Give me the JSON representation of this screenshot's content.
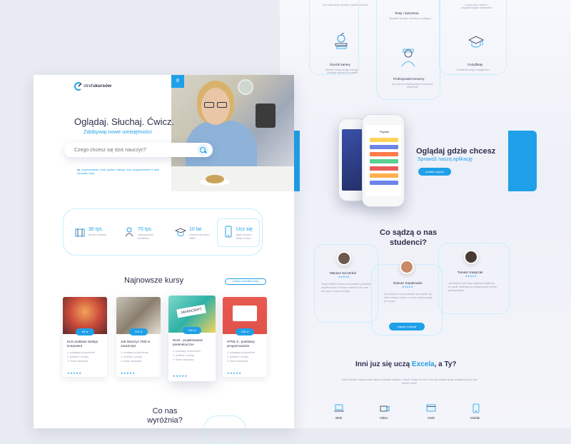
{
  "colors": {
    "accent": "#1fa0e8",
    "text": "#2b2f4a",
    "muted": "#9aa0b4"
  },
  "top_features": [
    {
      "title": "",
      "desc": "Ucz się kiedy chcesz i gdzie chcesz",
      "icon": "none"
    },
    {
      "title": "Testy i ćwiczenia",
      "desc": "Sprawdź wiedzę i utrwal ją w praktyce",
      "icon": "none"
    },
    {
      "title": "",
      "desc": "Uczysz się z plików i przygotowanych materiałów",
      "icon": "none"
    },
    {
      "title": "Ścieżki kariery",
      "desc": "Wybierz swoją drogę rozwoju i zdobądź wymarzony zawód",
      "icon": "apple-books-icon"
    },
    {
      "title": "Profesjonalni trenerzy",
      "desc": "Ucz się od certyfikowanych trenerów i ekspertów",
      "icon": "trainer-icon"
    },
    {
      "title": "Certyfikaty",
      "desc": "Potwierdź swoje umiejętności",
      "icon": "graduation-cap-icon"
    }
  ],
  "header": {
    "logo_text_light": "strefa",
    "logo_text_bold": "kursów",
    "badge": "8"
  },
  "hero": {
    "title": "Oglądaj. Słuchaj. Ćwicz.",
    "subtitle": "Zdobywaj nowe umiejętności",
    "search_placeholder": "Czego chcesz się dziś nauczyć?",
    "tags_label": "np.",
    "tags": "programowanie, excel, grafika, obsługa, biuro, programowanie w Javie",
    "tags_more": "wszystkie kursy"
  },
  "stats": [
    {
      "value": "30 tys.",
      "label": "filmów i ćwiczeń",
      "icon": "film-icon"
    },
    {
      "value": "70 tys.",
      "label": "zadowolonych kursantów",
      "icon": "users-icon"
    },
    {
      "value": "10 lat",
      "label": "uczenia się online i offline",
      "icon": "graduation-cap-icon"
    },
    {
      "value": "Ucz się",
      "label": "gdzie chcesz i kiedy chcesz",
      "icon": "phone-icon"
    }
  ],
  "courses": {
    "heading": "Najnowsze kursy",
    "all_button": "Zobacz wszystkie kursy",
    "items": [
      {
        "price": "65 zł",
        "title": "Kurs podstaw obsługi komputera",
        "features": [
          "podstawy zrozumienia",
          "portfolio i umowy",
          "dobre narzędzia"
        ],
        "stars": "★★★★★",
        "color": "#c94a3a"
      },
      {
        "price": "119 zł",
        "title": "Jak stworzyć VMS w JavaScript",
        "features": [
          "podstawy zrozumienia",
          "portfolio i umowy",
          "dobre narzędzia"
        ],
        "stars": "★★★★★",
        "color": "#8a7e6e"
      },
      {
        "price": "169 zł",
        "title": "Revit - projektowanie parametryczne",
        "features": [
          "podstawy zrozumienia",
          "portfolio i umowy",
          "dobre narzędzia"
        ],
        "stars": "★★★★★",
        "color": "#2fb2a6"
      },
      {
        "price": "189 zł",
        "title": "HTML 5 - podstawy programowania",
        "features": [
          "podstawy zrozumienia",
          "portfolio i umowy",
          "dobre narzędzia"
        ],
        "stars": "★★★★★",
        "color": "#e0524a"
      }
    ]
  },
  "why": {
    "line1": "Co nas",
    "line2": "wyróżnia?"
  },
  "app": {
    "title": "Oglądaj gdzie chcesz",
    "subtitle": "Sprawdź naszą aplikację",
    "button": "pobierz więcej",
    "phone_header": "Playlista"
  },
  "testimonials": {
    "heading_line1": "Co sądzą o nas",
    "heading_line2": "studenci?",
    "button": "więcej recenzji",
    "items": [
      {
        "name": "Mariusz Szczerbal",
        "stars": "★★★★★",
        "text": "Dzięki Strefie Kursów zrozumiałem podstawy projektowania. Polecam każdemu kto chce się uczyć w swoim tempie."
      },
      {
        "name": "Dariusz Sopakowski",
        "stars": "★★★★★",
        "text": "Kurs bardzo mi się podobał, nauczyłem się wielu nowych rzeczy i od razu wykorzystuję je w pracy."
      },
      {
        "name": "Tomasz Kasprzak",
        "stars": "★★★★★",
        "text": "Jak dotąd to jest moja najlepsza platforma do nauki. Materiały są przygotowane bardzo profesjonalnie."
      }
    ]
  },
  "others": {
    "heading_prefix": "Inni juz się uczą ",
    "heading_highlight": "Excela",
    "heading_suffix": ", a Ty?",
    "paragraph": "Nasi kursanci chwalą sobie naukę w każdym miejscu i czasie. Dołącz do nich i zacznij rozwijać swoje umiejętności już dziś razem z nami.",
    "categories": [
      {
        "label": "Web",
        "icon": "laptop-icon"
      },
      {
        "label": "Video",
        "icon": "camera-icon"
      },
      {
        "label": "CMS",
        "icon": "browser-icon"
      },
      {
        "label": "Mobile",
        "icon": "mobile-icon"
      }
    ]
  }
}
